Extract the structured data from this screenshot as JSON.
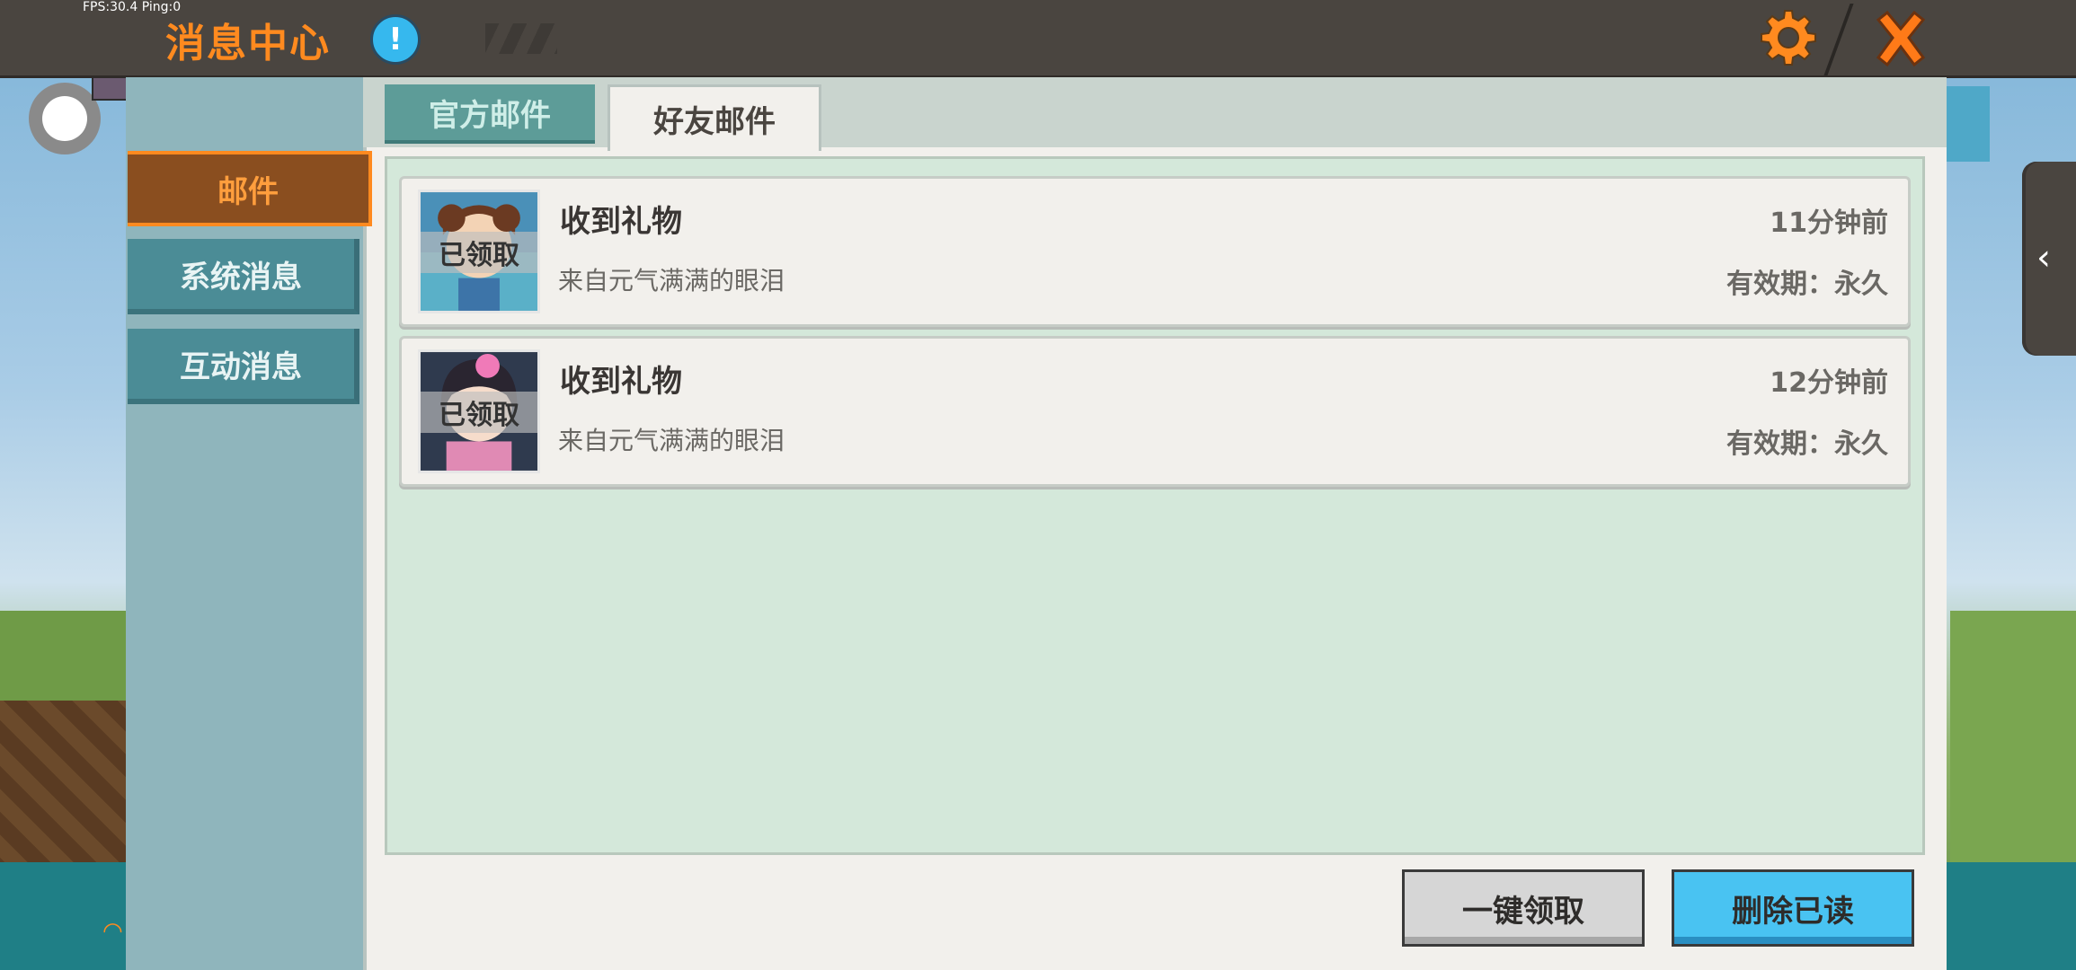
{
  "status": {
    "fps_text": "FPS:30.4  Ping:0"
  },
  "header": {
    "title": "消息中心",
    "info_icon": "exclamation-icon",
    "settings_icon": "gear-icon",
    "close_icon": "close-x-icon"
  },
  "sidebar": {
    "items": [
      {
        "label": "邮件",
        "active": true
      },
      {
        "label": "系统消息",
        "active": false
      },
      {
        "label": "互动消息",
        "active": false
      }
    ]
  },
  "tabs": [
    {
      "label": "官方邮件",
      "active": false
    },
    {
      "label": "好友邮件",
      "active": true
    }
  ],
  "mails": [
    {
      "title": "收到礼物",
      "from": "来自元气满满的眼泪",
      "time": "11分钟前",
      "validity": "有效期：永久",
      "status": "已领取"
    },
    {
      "title": "收到礼物",
      "from": "来自元气满满的眼泪",
      "time": "12分钟前",
      "validity": "有效期：永久",
      "status": "已领取"
    }
  ],
  "actions": {
    "claim_all": "一键领取",
    "delete_read": "删除已读"
  },
  "colors": {
    "accent": "#ff8a1f",
    "blue_button": "#49c3f2",
    "teal": "#4b8c96"
  }
}
